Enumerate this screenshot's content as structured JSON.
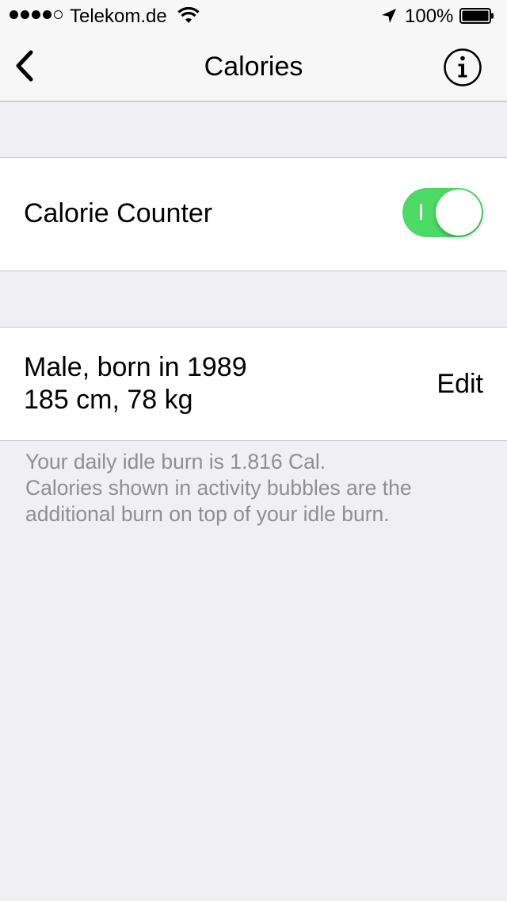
{
  "status_bar": {
    "carrier": "Telekom.de",
    "battery_percent": "100%",
    "signal_bars_filled": 4,
    "signal_bars_total": 5,
    "wifi_icon": "wifi-icon",
    "location_icon": "location-arrow-icon",
    "battery_icon": "battery-icon"
  },
  "nav": {
    "title": "Calories",
    "back_icon": "chevron-left-icon",
    "info_icon": "info-icon"
  },
  "calorie_counter": {
    "label": "Calorie Counter",
    "enabled": true,
    "toggle_on_color": "#4cd964"
  },
  "profile": {
    "line1": "Male, born in 1989",
    "line2": "185 cm, 78 kg",
    "edit_label": "Edit"
  },
  "footnote": {
    "line1": "Your daily idle burn is 1.816 Cal.",
    "line2": "Calories shown in activity bubbles are the",
    "line3": "additional burn on top of your idle burn."
  },
  "colors": {
    "background": "#efeff4",
    "bar_background": "#f7f7f7",
    "separator": "#c8c7cc",
    "footnote_text": "#8e8e93"
  }
}
